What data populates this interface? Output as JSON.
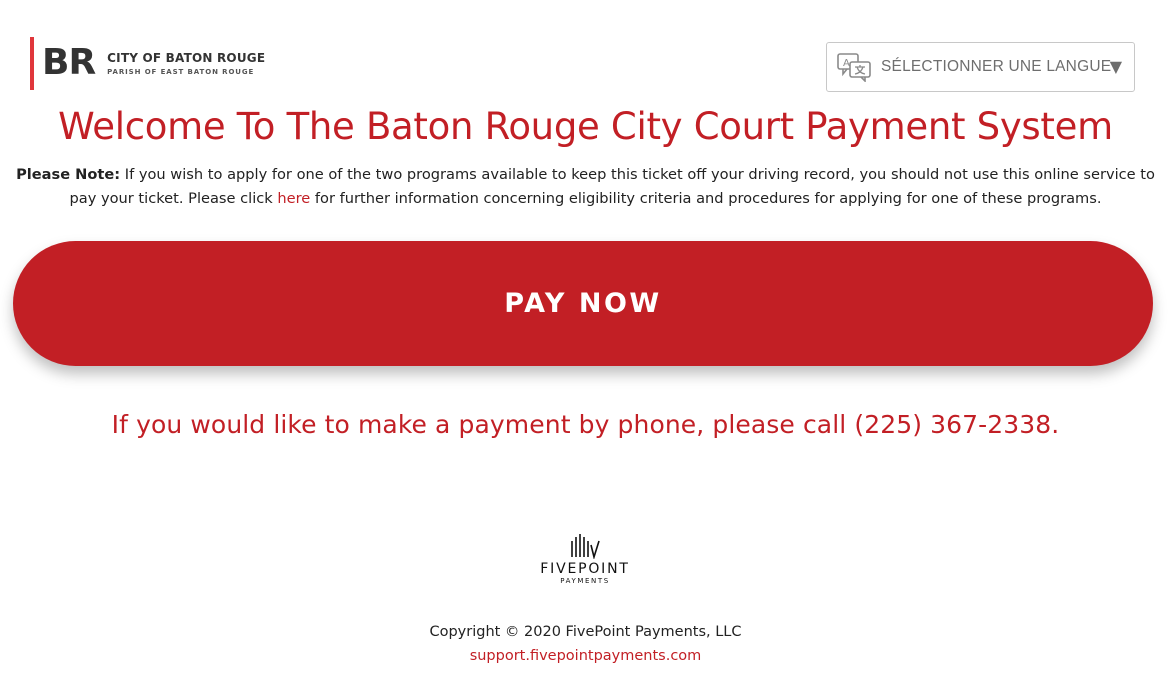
{
  "header": {
    "logo": {
      "initials": "BR",
      "title": "CITY OF BATON ROUGE",
      "subtitle": "PARISH OF EAST BATON ROUGE"
    },
    "language_select": {
      "label": "SÉLECTIONNER UNE LANGUE",
      "icon": "translate-icon",
      "caret": "▼"
    }
  },
  "main": {
    "title": "Welcome To The Baton Rouge City Court Payment System",
    "note": {
      "label": "Please Note:",
      "text_before_link": " If you wish to apply for one of the two programs available to keep this ticket off your driving record, you should not use this online service to pay your ticket. Please click ",
      "link_text": "here",
      "text_after_link": " for further information concerning eligibility criteria and procedures for applying for one of these programs."
    },
    "pay_button_label": "PAY NOW",
    "phone_text": "If you would like to make a payment by phone, please call (225) 367-2338."
  },
  "footer": {
    "brand_name": "FIVEPOINT",
    "brand_sub": "PAYMENTS",
    "copyright": "Copyright © 2020 FivePoint Payments, LLC",
    "support_link": "support.fivepointpayments.com"
  },
  "colors": {
    "accent": "#c21f25",
    "logo_bar": "#e0363b"
  }
}
